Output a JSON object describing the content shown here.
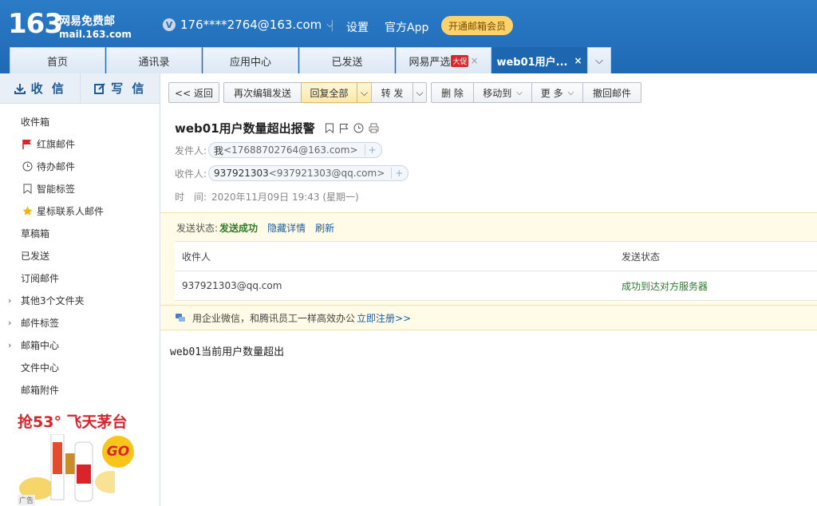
{
  "header": {
    "logo_number": "163",
    "logo_cn": "网易免费邮",
    "logo_domain": "mail.163.com",
    "account_badge": "V",
    "account": "176****2764@163.com",
    "separator": "|",
    "settings": "设置",
    "app": "官方App",
    "vip_button": "开通邮箱会员",
    "colors": {
      "bar": "#1f69b4",
      "vip": "#fbd36a"
    }
  },
  "tabs": [
    {
      "label": "首页"
    },
    {
      "label": "通讯录"
    },
    {
      "label": "应用中心"
    },
    {
      "label": "已发送"
    },
    {
      "label": "网易严选",
      "badge": "大促",
      "close": "×"
    },
    {
      "label": "web01用户...",
      "close": "×",
      "active": true
    }
  ],
  "sidebar": {
    "receive": "收 信",
    "compose": "写 信",
    "folders": [
      {
        "label": "收件箱"
      },
      {
        "label": "红旗邮件",
        "icon": "flag-icon"
      },
      {
        "label": "待办邮件",
        "icon": "clock-icon"
      },
      {
        "label": "智能标签",
        "icon": "bookmark-icon"
      },
      {
        "label": "星标联系人邮件",
        "icon": "star-icon"
      },
      {
        "label": "草稿箱"
      },
      {
        "label": "已发送"
      },
      {
        "label": "订阅邮件"
      },
      {
        "label": "其他3个文件夹",
        "expandable": true
      },
      {
        "label": "邮件标签",
        "expandable": true
      },
      {
        "label": "邮箱中心",
        "expandable": true
      },
      {
        "label": "文件中心"
      },
      {
        "label": "邮箱附件"
      }
    ],
    "ad": {
      "title": "抢53° 飞天茅台",
      "go": "GO",
      "tag": "广告"
    }
  },
  "toolbar": {
    "back": "<< 返回",
    "re_edit": "再次编辑发送",
    "reply_all": "回复全部",
    "forward": "转 发",
    "delete": "删 除",
    "move_to": "移动到",
    "more": "更 多",
    "recall": "撤回邮件"
  },
  "mail": {
    "subject": "web01用户数量超出报警",
    "sender_label": "发件人:",
    "sender_name": "我",
    "sender_addr": "<17688702764@163.com>",
    "recipient_label": "收件人:",
    "recipient_name": "937921303",
    "recipient_addr": "<937921303@qq.com>",
    "time_label": "时　间:",
    "time_value": "2020年11月09日 19:43 (星期一)",
    "body": "web01当前用户数量超出"
  },
  "status": {
    "label": "发送状态:",
    "result": "发送成功",
    "hide_details": "隐藏详情",
    "refresh": "刷新",
    "columns": [
      "收件人",
      "发送状态"
    ],
    "rows": [
      {
        "recipient": "937921303@qq.com",
        "state": "成功到达对方服务器"
      }
    ]
  },
  "promo": {
    "text": "用企业微信，和腾讯员工一样高效办公",
    "link": "立即注册>>"
  }
}
